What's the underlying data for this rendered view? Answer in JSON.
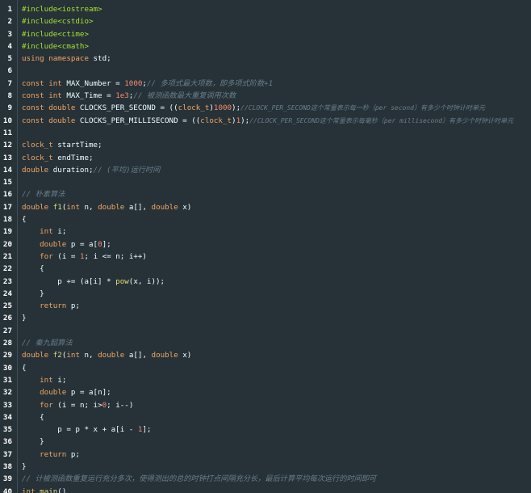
{
  "editor": {
    "lines": [
      {
        "n": "1",
        "tokens": [
          [
            "pre",
            "#include"
          ],
          [
            "hdr",
            "<iostream>"
          ]
        ]
      },
      {
        "n": "2",
        "tokens": [
          [
            "pre",
            "#include"
          ],
          [
            "hdr",
            "<cstdio>"
          ]
        ]
      },
      {
        "n": "3",
        "tokens": [
          [
            "pre",
            "#include"
          ],
          [
            "hdr",
            "<ctime>"
          ]
        ]
      },
      {
        "n": "4",
        "tokens": [
          [
            "pre",
            "#include"
          ],
          [
            "hdr",
            "<cmath>"
          ]
        ]
      },
      {
        "n": "5",
        "tokens": [
          [
            "kw",
            "using namespace"
          ],
          [
            "id",
            " std;"
          ]
        ]
      },
      {
        "n": "6",
        "tokens": []
      },
      {
        "n": "7",
        "tokens": [
          [
            "kw",
            "const int"
          ],
          [
            "id",
            " MAX_Number = "
          ],
          [
            "num",
            "1000"
          ],
          [
            "id",
            ";"
          ],
          [
            "cm",
            "// 多项式最大项数，即多项式阶数+1"
          ]
        ]
      },
      {
        "n": "8",
        "tokens": [
          [
            "kw",
            "const int"
          ],
          [
            "id",
            " MAX_Time = "
          ],
          [
            "num",
            "1e3"
          ],
          [
            "id",
            ";"
          ],
          [
            "cm",
            "// 被测函数最大重复调用次数"
          ]
        ]
      },
      {
        "n": "9",
        "tokens": [
          [
            "kw",
            "const double"
          ],
          [
            "id",
            " CLOCKS_PER_SECOND = (("
          ],
          [
            "type",
            "clock_t"
          ],
          [
            "id",
            ")"
          ],
          [
            "num",
            "1000"
          ],
          [
            "id",
            ");"
          ],
          [
            "cmsm",
            "//CLOCK_PER_SECOND这个常量表示每一秒（per second）有多少个时钟计时单元"
          ]
        ]
      },
      {
        "n": "10",
        "tokens": [
          [
            "kw",
            "const double"
          ],
          [
            "id",
            " CLOCKS_PER_MILLISECOND = (("
          ],
          [
            "type",
            "clock_t"
          ],
          [
            "id",
            ")"
          ],
          [
            "num",
            "1"
          ],
          [
            "id",
            ");"
          ],
          [
            "cmsm",
            "//CLOCK_PER_SECOND这个常量表示每毫秒（per millisecond）有多少个时钟计时单元"
          ]
        ]
      },
      {
        "n": "11",
        "tokens": []
      },
      {
        "n": "12",
        "tokens": [
          [
            "type",
            "clock_t"
          ],
          [
            "id",
            " startTime;"
          ]
        ]
      },
      {
        "n": "13",
        "tokens": [
          [
            "type",
            "clock_t"
          ],
          [
            "id",
            " endTime;"
          ]
        ]
      },
      {
        "n": "14",
        "tokens": [
          [
            "kw",
            "double"
          ],
          [
            "id",
            " duration;"
          ],
          [
            "cm",
            "// (平均)运行时间"
          ]
        ]
      },
      {
        "n": "15",
        "tokens": []
      },
      {
        "n": "16",
        "tokens": [
          [
            "cm",
            "// 朴素算法"
          ]
        ]
      },
      {
        "n": "17",
        "tokens": [
          [
            "kw",
            "double"
          ],
          [
            "id",
            " "
          ],
          [
            "fn",
            "f1"
          ],
          [
            "id",
            "("
          ],
          [
            "kw",
            "int"
          ],
          [
            "id",
            " n, "
          ],
          [
            "kw",
            "double"
          ],
          [
            "id",
            " a[], "
          ],
          [
            "kw",
            "double"
          ],
          [
            "id",
            " x)"
          ]
        ]
      },
      {
        "n": "18",
        "tokens": [
          [
            "id",
            "{"
          ]
        ]
      },
      {
        "n": "19",
        "tokens": [
          [
            "id",
            "    "
          ],
          [
            "kw",
            "int"
          ],
          [
            "id",
            " i;"
          ]
        ]
      },
      {
        "n": "20",
        "tokens": [
          [
            "id",
            "    "
          ],
          [
            "kw",
            "double"
          ],
          [
            "id",
            " p = a["
          ],
          [
            "num",
            "0"
          ],
          [
            "id",
            "];"
          ]
        ]
      },
      {
        "n": "21",
        "tokens": [
          [
            "id",
            "    "
          ],
          [
            "kw",
            "for"
          ],
          [
            "id",
            " (i = "
          ],
          [
            "num",
            "1"
          ],
          [
            "id",
            "; i <= n; i++)"
          ]
        ]
      },
      {
        "n": "22",
        "tokens": [
          [
            "id",
            "    {"
          ]
        ]
      },
      {
        "n": "23",
        "tokens": [
          [
            "id",
            "        p += (a[i] * "
          ],
          [
            "fn",
            "pow"
          ],
          [
            "id",
            "(x, i));"
          ]
        ]
      },
      {
        "n": "24",
        "tokens": [
          [
            "id",
            "    }"
          ]
        ]
      },
      {
        "n": "25",
        "tokens": [
          [
            "id",
            "    "
          ],
          [
            "kw",
            "return"
          ],
          [
            "id",
            " p;"
          ]
        ]
      },
      {
        "n": "26",
        "tokens": [
          [
            "id",
            "}"
          ]
        ]
      },
      {
        "n": "27",
        "tokens": []
      },
      {
        "n": "28",
        "tokens": [
          [
            "cm",
            "// 秦九韶算法"
          ]
        ]
      },
      {
        "n": "29",
        "tokens": [
          [
            "kw",
            "double"
          ],
          [
            "id",
            " "
          ],
          [
            "fn",
            "f2"
          ],
          [
            "id",
            "("
          ],
          [
            "kw",
            "int"
          ],
          [
            "id",
            " n, "
          ],
          [
            "kw",
            "double"
          ],
          [
            "id",
            " a[], "
          ],
          [
            "kw",
            "double"
          ],
          [
            "id",
            " x)"
          ]
        ]
      },
      {
        "n": "30",
        "tokens": [
          [
            "id",
            "{"
          ]
        ]
      },
      {
        "n": "31",
        "tokens": [
          [
            "id",
            "    "
          ],
          [
            "kw",
            "int"
          ],
          [
            "id",
            " i;"
          ]
        ]
      },
      {
        "n": "32",
        "tokens": [
          [
            "id",
            "    "
          ],
          [
            "kw",
            "double"
          ],
          [
            "id",
            " p = a[n];"
          ]
        ]
      },
      {
        "n": "33",
        "tokens": [
          [
            "id",
            "    "
          ],
          [
            "kw",
            "for"
          ],
          [
            "id",
            " (i = n; i>"
          ],
          [
            "num",
            "0"
          ],
          [
            "id",
            "; i--)"
          ]
        ]
      },
      {
        "n": "34",
        "tokens": [
          [
            "id",
            "    {"
          ]
        ]
      },
      {
        "n": "35",
        "tokens": [
          [
            "id",
            "        p = p * x + a[i - "
          ],
          [
            "num",
            "1"
          ],
          [
            "id",
            "];"
          ]
        ]
      },
      {
        "n": "36",
        "tokens": [
          [
            "id",
            "    }"
          ]
        ]
      },
      {
        "n": "37",
        "tokens": [
          [
            "id",
            "    "
          ],
          [
            "kw",
            "return"
          ],
          [
            "id",
            " p;"
          ]
        ]
      },
      {
        "n": "38",
        "tokens": [
          [
            "id",
            "}"
          ]
        ]
      },
      {
        "n": "39",
        "tokens": [
          [
            "cm",
            "// 计被测函数重复运行充分多次，使得测出的总的时钟打点间隔充分长，最后计算平均每次运行的时间即可"
          ]
        ]
      },
      {
        "n": "40",
        "tokens": [
          [
            "kw",
            "int"
          ],
          [
            "id",
            " "
          ],
          [
            "fn",
            "main"
          ],
          [
            "id",
            "()"
          ]
        ]
      }
    ]
  }
}
